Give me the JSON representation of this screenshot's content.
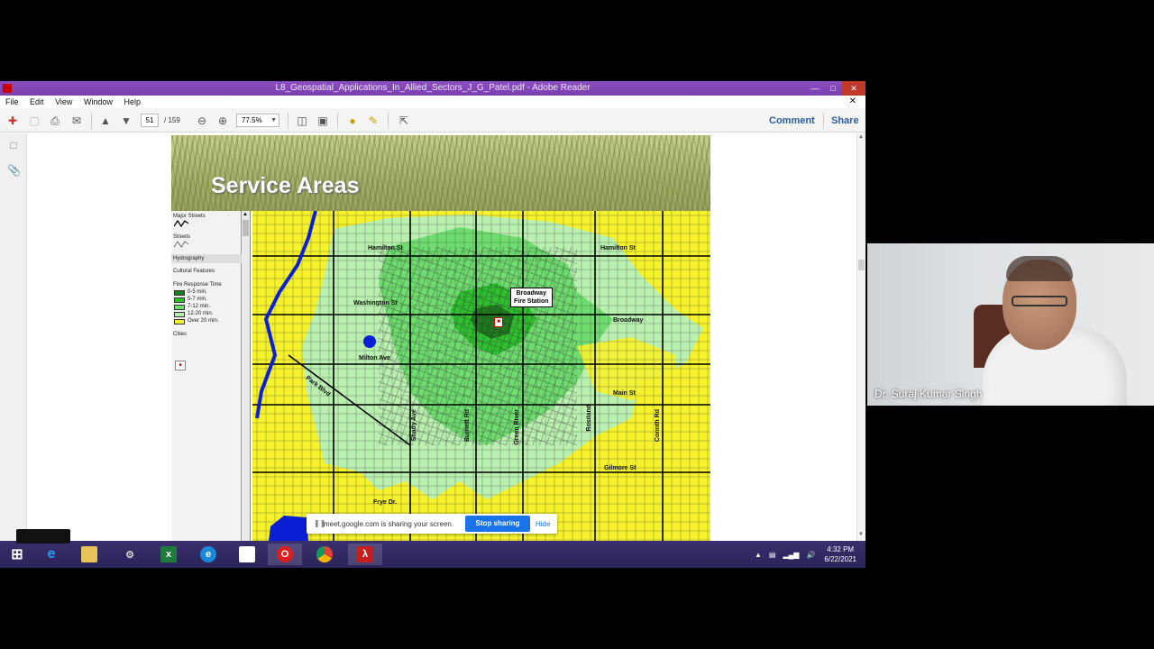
{
  "reader": {
    "title": "L8_Geospatial_Applications_In_Allied_Sectors_J_G_Patel.pdf - Adobe Reader",
    "menu": [
      "File",
      "Edit",
      "View",
      "Window",
      "Help"
    ],
    "page_current": "51",
    "page_total": "/ 159",
    "zoom": "77.5%",
    "comment_label": "Comment",
    "share_label": "Share"
  },
  "slide": {
    "title": "Service Areas",
    "legend": {
      "major_streets": "Major Streets",
      "streets": "Streets",
      "hydrography": "Hydrography",
      "cultural": "Cultural Features",
      "fire_response": "Fire Response Time",
      "items": [
        {
          "label": "0-5 min.",
          "color": "#1e7a1e"
        },
        {
          "label": "5-7 min.",
          "color": "#2fc02f"
        },
        {
          "label": "7-12 min.",
          "color": "#6fdc6f"
        },
        {
          "label": "12-20 min.",
          "color": "#b9f0b0"
        },
        {
          "label": "Over 20 min.",
          "color": "#f5f22c"
        }
      ],
      "cities": "Cities"
    },
    "map_labels": {
      "hamilton1": "Hamilton St",
      "hamilton2": "Hamilton St",
      "washington": "Washington St",
      "broadway": "Broadway",
      "milton": "Milton Ave",
      "main": "Main St",
      "gilmore": "Gilmore St",
      "frye": "Frye Dr.",
      "park": "Park Blvd",
      "shady": "Shady Ave",
      "burnett": "Burnett Rd",
      "green": "Green River",
      "rosiland": "Rosiland",
      "corinth": "Corinth Rd",
      "callout_line1": "Broadway",
      "callout_line2": "Fire Station"
    }
  },
  "share_banner": {
    "message": "meet.google.com is sharing your screen.",
    "stop_label": "Stop sharing",
    "hide_label": "Hide"
  },
  "taskbar": {
    "time": "4:32 PM",
    "date": "6/22/2021"
  },
  "video": {
    "participant_name": "Dr. Suraj Kumar Singh"
  },
  "colors": {
    "title_bar": "#7a3fb0",
    "taskbar": "#2a2358",
    "stop_button": "#1a73e8"
  }
}
